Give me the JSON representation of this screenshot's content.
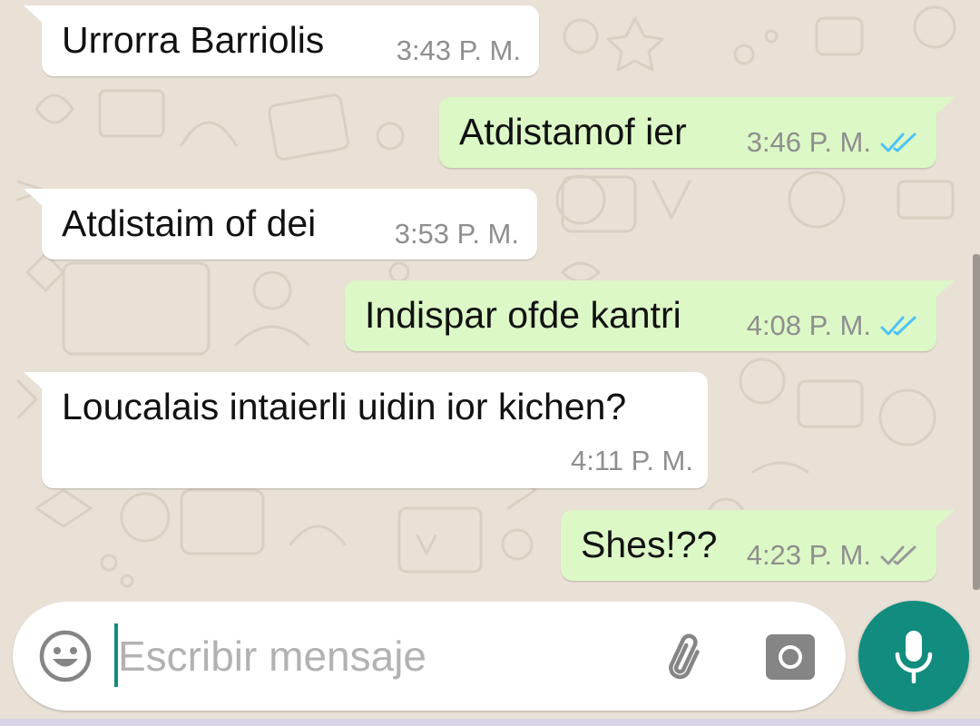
{
  "messages": [
    {
      "text": "Urrorra Barriolis",
      "time": "3:43 P. M.",
      "direction": "in",
      "tail": true
    },
    {
      "text": "Atdistamof ier",
      "time": "3:46 P. M.",
      "direction": "out",
      "tail": true,
      "status": "read"
    },
    {
      "text": "Atdistaim of dei",
      "time": "3:53 P. M.",
      "direction": "in",
      "tail": true
    },
    {
      "text": "Indispar ofde kantri",
      "time": "4:08 P. M.",
      "direction": "out",
      "tail": true,
      "status": "read"
    },
    {
      "text": "Loucalais intaierli uidin ior kichen?",
      "time": "4:11 P. M.",
      "direction": "in",
      "tail": true
    },
    {
      "text": "Shes!??",
      "time": "4:23 P. M.",
      "direction": "out",
      "tail": true,
      "status": "delivered"
    }
  ],
  "composer": {
    "placeholder": "Escribir mensaje",
    "value": "",
    "emoji_icon": "smiley-face-icon",
    "attach_icon": "paperclip-icon",
    "camera_icon": "camera-icon"
  },
  "mic_button": {
    "icon": "microphone-icon"
  },
  "colors": {
    "wallpaper": "#e9e1d6",
    "incoming_bubble": "#ffffff",
    "outgoing_bubble": "#dcf8c6",
    "read_ticks": "#4fc3f7",
    "delivered_ticks": "#9a9a9a",
    "accent": "#128c7e",
    "timestamp": "#8f8f8f"
  }
}
